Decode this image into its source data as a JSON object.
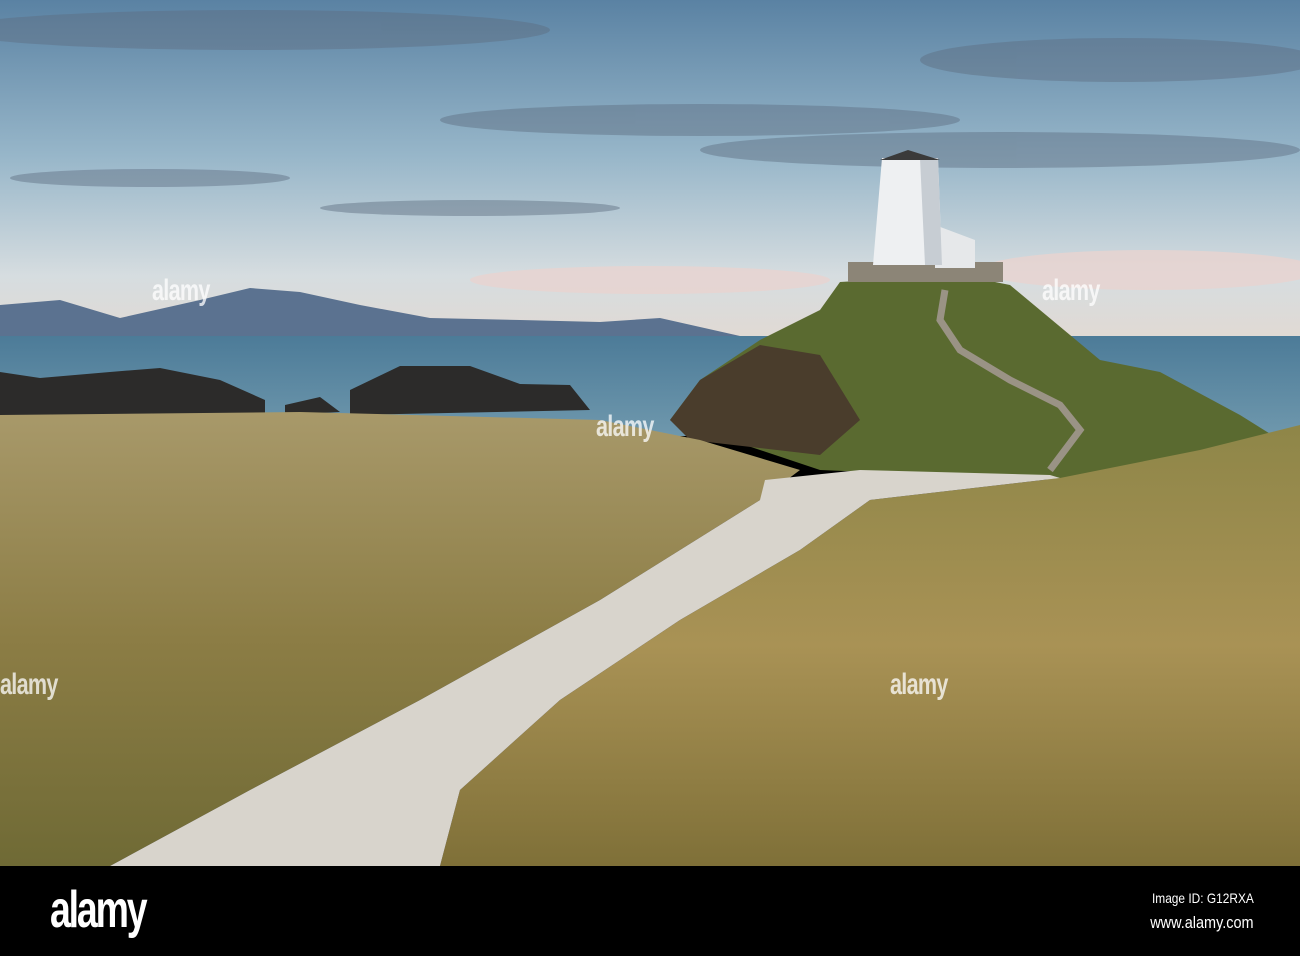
{
  "photo": {
    "subject": "lighthouse",
    "palette": {
      "sky_top": "#5f86a6",
      "sky_bottom": "#d9dde0",
      "sea": "#4f7d99",
      "grass": "#9c8a4e",
      "path": "#d8d4cc",
      "tower": "#eef0f2"
    }
  },
  "watermark": {
    "text": "alamy"
  },
  "footer": {
    "logo": "alamy",
    "image_id": "Image ID: G12RXA",
    "website": "www.alamy.com"
  }
}
